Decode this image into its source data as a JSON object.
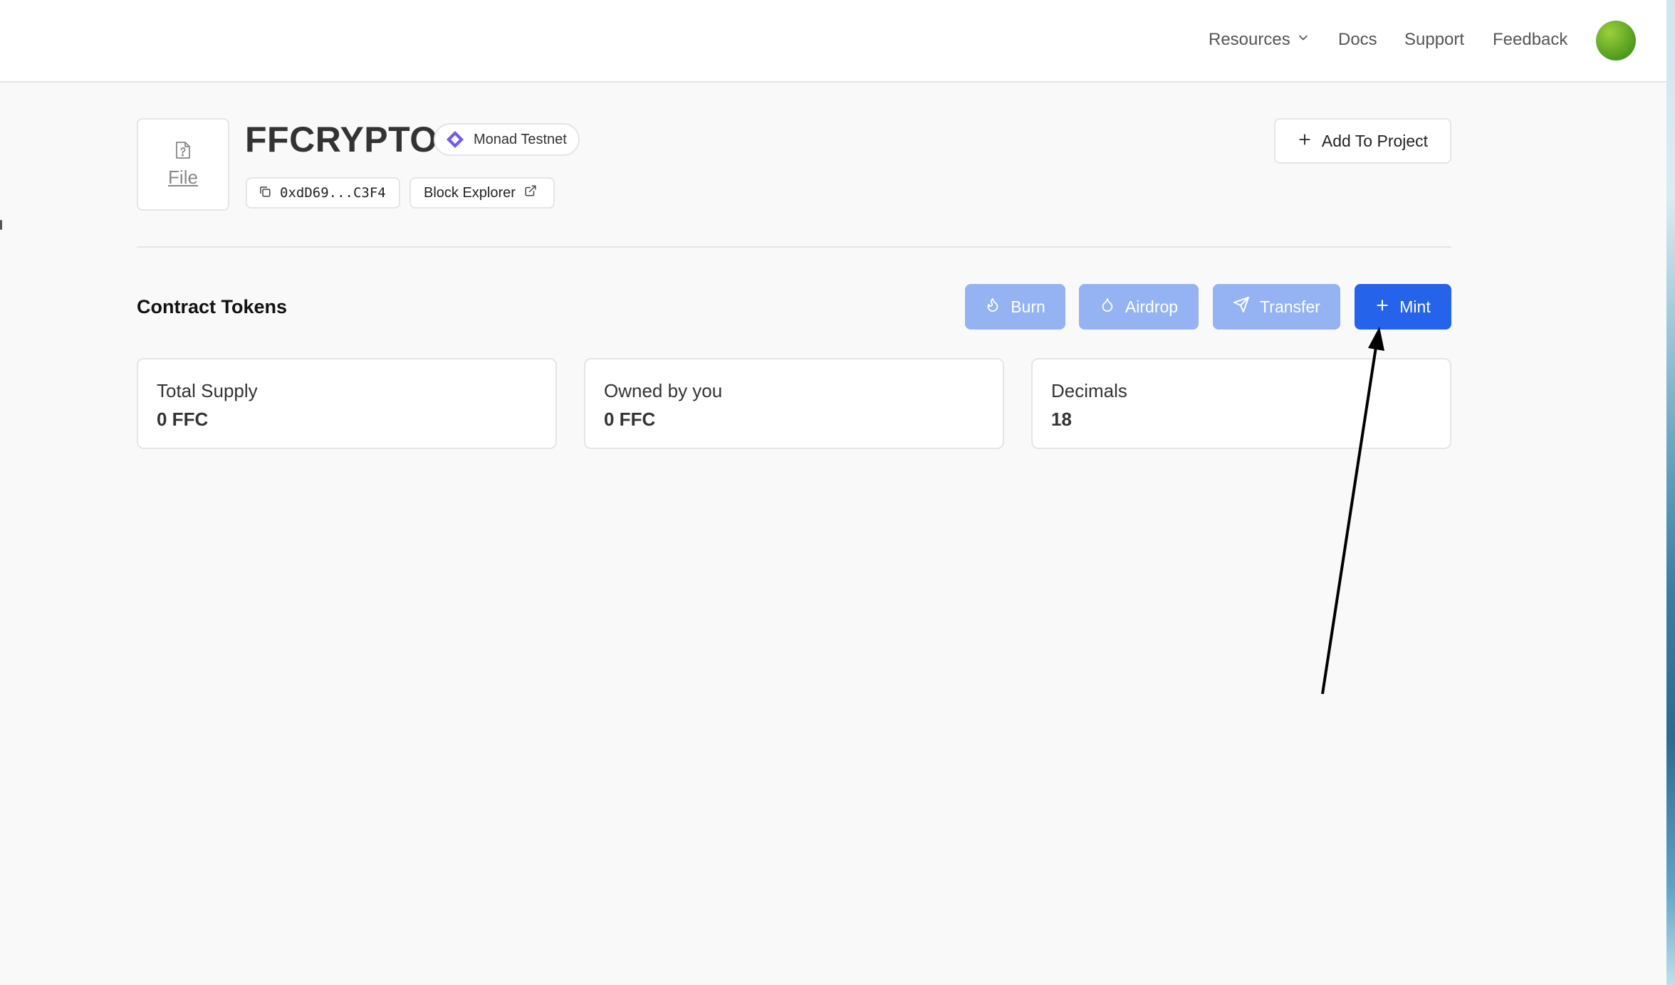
{
  "header": {
    "nav": {
      "resources": "Resources",
      "docs": "Docs",
      "support": "Support",
      "feedback": "Feedback"
    }
  },
  "contract": {
    "file_label": "File",
    "name": "FFCRYPTO",
    "chain": "Monad Testnet",
    "address": "0xdD69...C3F4",
    "explorer_label": "Block Explorer",
    "add_to_project_label": "Add To Project"
  },
  "tokens": {
    "section_title": "Contract Tokens",
    "actions": {
      "burn": "Burn",
      "airdrop": "Airdrop",
      "transfer": "Transfer",
      "mint": "Mint"
    },
    "stats": [
      {
        "label": "Total Supply",
        "value": "0 FFC"
      },
      {
        "label": "Owned by you",
        "value": "0 FFC"
      },
      {
        "label": "Decimals",
        "value": "18"
      }
    ]
  },
  "colors": {
    "primary": "#2563eb",
    "primary_disabled": "#95b3f3",
    "chain_accent": "#6e5bf0"
  },
  "icons": {
    "resources": "chevron-down-icon",
    "file": "file-question-icon",
    "chain": "monad-icon",
    "address": "copy-icon",
    "explorer": "external-link-icon",
    "add": "plus-icon",
    "burn": "flame-icon",
    "airdrop": "droplet-icon",
    "transfer": "send-icon",
    "mint": "plus-icon"
  }
}
